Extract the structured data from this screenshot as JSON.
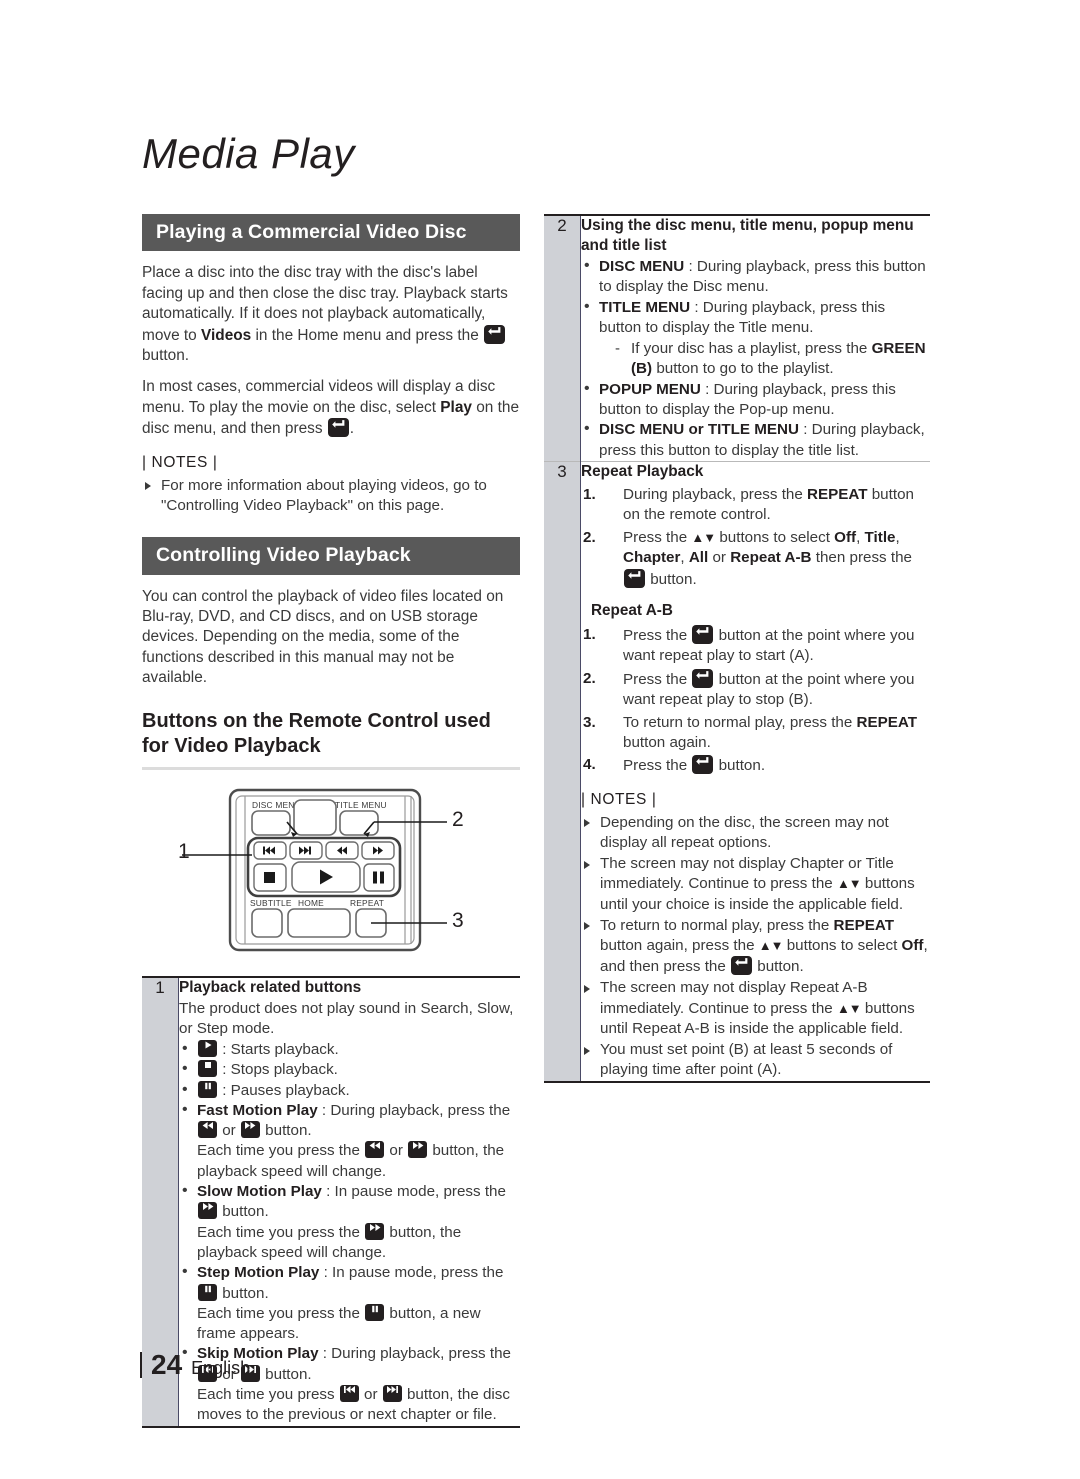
{
  "page": {
    "title": "Media Play",
    "page_number": "24",
    "language": "English"
  },
  "left": {
    "section1": {
      "header": "Playing a Commercial Video Disc",
      "para1_a": "Place a disc into the disc tray with the disc's label facing up and then close the disc tray. Playback starts automatically. If it does not playback automatically, move to ",
      "para1_b": "Videos",
      "para1_c": " in the Home menu and press the ",
      "para1_d": " button.",
      "para2_a": "In most cases, commercial videos will display a disc menu. To play the movie on the disc, select ",
      "para2_b": "Play",
      "para2_c": " on the disc menu, and then press ",
      "para2_d": ".",
      "notes_label": "| NOTES |",
      "notes": [
        "For more information about playing videos, go to \"Controlling Video Playback\" on this page."
      ]
    },
    "section2": {
      "header": "Controlling Video Playback",
      "para1": "You can control the playback of video files located on Blu-ray, DVD, and CD discs, and on USB storage devices. Depending on the media, some of the functions described in this manual may not be available.",
      "subhead": "Buttons on the Remote Control used for Video Playback"
    },
    "remote": {
      "label_disc_menu": "DISC MENU",
      "label_title_menu": "TITLE MENU",
      "label_subtitle": "SUBTITLE",
      "label_home": "HOME",
      "label_repeat": "REPEAT",
      "callout_1": "1",
      "callout_2": "2",
      "callout_3": "3"
    },
    "table": {
      "row1_number": "1",
      "row1_heading": "Playback related buttons",
      "row1_intro": "The product does not play sound in Search, Slow, or Step mode.",
      "bullets": [
        {
          "icon": "play-icon",
          "text": " : Starts playback."
        },
        {
          "icon": "stop-icon",
          "text": " : Stops playback."
        },
        {
          "icon": "pause-icon",
          "text": " : Pauses playback."
        }
      ],
      "fast_motion_label": "Fast Motion Play",
      "fast_motion_a": " : During playback, press the ",
      "fast_motion_b": " or ",
      "fast_motion_c": " button.",
      "fast_motion_d": "Each time you press the ",
      "fast_motion_e": " or ",
      "fast_motion_f": " button, the playback speed will change.",
      "slow_motion_label": "Slow Motion Play",
      "slow_motion_a": " : In pause mode, press the ",
      "slow_motion_b": " button.",
      "slow_motion_c": "Each time you press the ",
      "slow_motion_d": " button, the playback speed will change.",
      "step_motion_label": "Step Motion Play",
      "step_motion_a": " : In pause mode, press the ",
      "step_motion_b": " button.",
      "step_motion_c": "Each time you press the ",
      "step_motion_d": " button, a new frame appears.",
      "skip_motion_label": "Skip Motion Play",
      "skip_motion_a": " : During playback, press the ",
      "skip_motion_b": " or ",
      "skip_motion_c": " button.",
      "skip_motion_d": "Each time you press ",
      "skip_motion_e": " or ",
      "skip_motion_f": " button, the disc moves to the previous or next chapter or file."
    }
  },
  "right": {
    "row2": {
      "number": "2",
      "heading": "Using the disc menu, title menu, popup menu and title list",
      "b1_label": "DISC MENU",
      "b1_text": " : During playback, press this button to display the Disc menu.",
      "b2_label": "TITLE MENU",
      "b2_text": " : During playback, press this button to display the Title menu.",
      "b2_dash_a": "If your disc has a playlist, press the ",
      "b2_dash_green": "GREEN",
      "b2_dash_b": " ",
      "b2_dash_bb": "(B)",
      "b2_dash_c": " button to go to the playlist.",
      "b3_label": "POPUP MENU",
      "b3_text": " : During playback, press this button to display the Pop-up menu.",
      "b4_label": "DISC MENU or TITLE MENU",
      "b4_text": " : During playback, press this button to display the title list."
    },
    "row3": {
      "number": "3",
      "heading": "Repeat Playback",
      "step1_a": "During playback, press the ",
      "step1_b": "REPEAT",
      "step1_c": " button on the remote control.",
      "step2_a": "Press the ",
      "step2_arrows": "▲▼",
      "step2_b": " buttons to select ",
      "step2_off": "Off",
      "step2_c": ", ",
      "step2_title": "Title",
      "step2_d": ", ",
      "step2_chapter": "Chapter",
      "step2_e": ", ",
      "step2_all": "All",
      "step2_f": " or ",
      "step2_ab": "Repeat A-B",
      "step2_g": " then press the ",
      "step2_h": " button.",
      "sub_label": "Repeat A-B",
      "ab_step1_a": "Press the ",
      "ab_step1_b": " button at the point where you want repeat play to start (A).",
      "ab_step2_a": "Press the ",
      "ab_step2_b": " button at the point where you want repeat play to stop (B).",
      "ab_step3_a": "To return to normal play, press the ",
      "ab_step3_b": "REPEAT",
      "ab_step3_c": " button again.",
      "ab_step4_a": "Press the ",
      "ab_step4_b": " button.",
      "notes_label": "| NOTES |",
      "note1": "Depending on the disc, the screen may not display all repeat options.",
      "note2_a": "The screen may not display Chapter or Title immediately. Continue to press the ",
      "note2_arrows": "▲▼",
      "note2_b": " buttons until your choice is inside the applicable field.",
      "note3_a": "To return to normal play, press the ",
      "note3_repeat": "REPEAT",
      "note3_b": " button again, press the ",
      "note3_arrows": "▲▼",
      "note3_c": " buttons to select ",
      "note3_off": "Off",
      "note3_d": ", and then press the ",
      "note3_e": " button.",
      "note4_a": "The screen may not display Repeat A-B immediately. Continue to press the ",
      "note4_arrows": "▲▼",
      "note4_b": " buttons until Repeat A-B is inside the applicable field.",
      "note5": "You must set point (B) at least 5 seconds of playing time after point (A)."
    }
  },
  "colors": {
    "header_bar": "#595959",
    "number_cell": "#cfd1d6",
    "text": "#3a3a3a",
    "rule": "#dcdcdc"
  }
}
